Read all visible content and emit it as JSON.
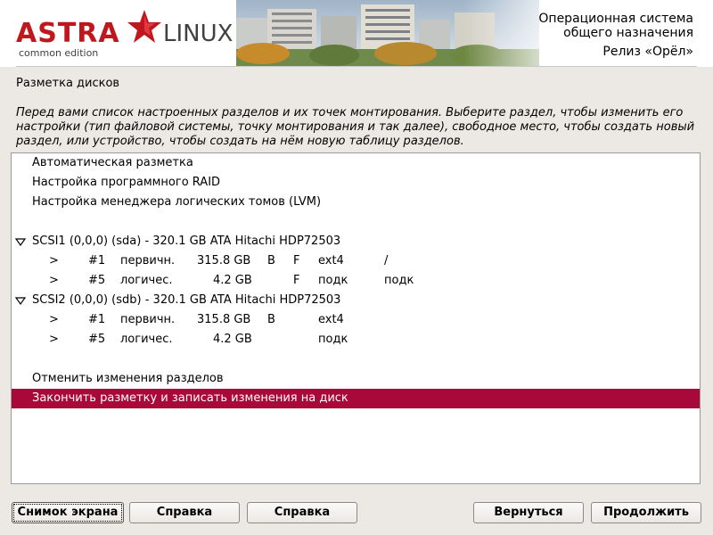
{
  "header": {
    "logo_astra": "ASTRA",
    "logo_linux": "LINUX",
    "logo_sub": "common edition",
    "title_line1": "Операционная система",
    "title_line2": "общего назначения",
    "title_line3": "Релиз «Орёл»"
  },
  "page": {
    "title": "Разметка дисков",
    "description": "Перед вами список настроенных разделов и их точек монтирования. Выберите раздел, чтобы изменить его настройки (тип файловой системы, точку монтирования и так далее), свободное место, чтобы создать новый раздел, или устройство, чтобы создать на нём новую таблицу разделов."
  },
  "list": {
    "auto": "Автоматическая разметка",
    "raid": "Настройка программного RAID",
    "lvm": "Настройка менеджера логических томов (LVM)",
    "disk1": "SCSI1 (0,0,0) (sda) - 320.1 GB ATA Hitachi HDP72503",
    "disk1_parts": [
      {
        "arrow": ">",
        "num": "#1",
        "type": "первичн.",
        "size": "315.8 GB",
        "b": "B",
        "f": "F",
        "fs": "ext4",
        "mount": "/"
      },
      {
        "arrow": ">",
        "num": "#5",
        "type": "логичес.",
        "size": "4.2 GB",
        "b": "",
        "f": "F",
        "fs": "подк",
        "mount": "подк"
      }
    ],
    "disk2": "SCSI2 (0,0,0) (sdb) - 320.1 GB ATA Hitachi HDP72503",
    "disk2_parts": [
      {
        "arrow": ">",
        "num": "#1",
        "type": "первичн.",
        "size": "315.8 GB",
        "b": "B",
        "f": "",
        "fs": "ext4",
        "mount": ""
      },
      {
        "arrow": ">",
        "num": "#5",
        "type": "логичес.",
        "size": "4.2 GB",
        "b": "",
        "f": "",
        "fs": "подк",
        "mount": ""
      }
    ],
    "undo": "Отменить изменения разделов",
    "finish": "Закончить разметку и записать изменения на диск"
  },
  "buttons": {
    "screenshot": "Снимок экрана",
    "help1": "Справка",
    "help2": "Справка",
    "back": "Вернуться",
    "continue": "Продолжить"
  },
  "colors": {
    "selection": "#a8083a",
    "logo_red": "#c0161e"
  }
}
